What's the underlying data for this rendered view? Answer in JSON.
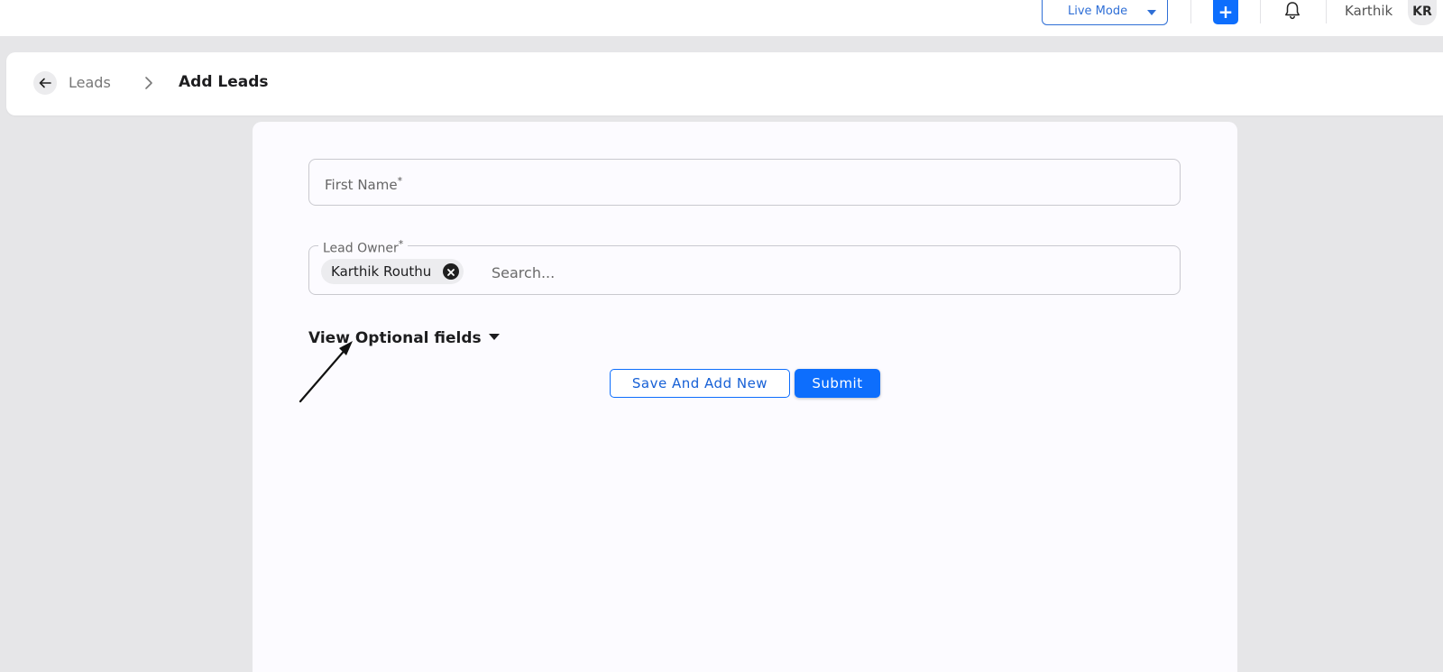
{
  "topbar": {
    "mode_label": "Live Mode",
    "add_label": "+",
    "user_name": "Karthik",
    "avatar_initials": "KR"
  },
  "breadcrumb": {
    "parent": "Leads",
    "current": "Add Leads"
  },
  "form": {
    "first_name_label": "First Name",
    "required_mark": "*",
    "lead_owner_label": "Lead Owner",
    "lead_owner_chip": "Karthik Routhu",
    "search_placeholder": "Search...",
    "optional_toggle": "View Optional fields",
    "save_and_add_label": "Save And Add New",
    "submit_label": "Submit"
  },
  "colors": {
    "accent": "#0d6efd",
    "page_bg": "#e6e6e8",
    "card_bg": "#fcfbff"
  }
}
